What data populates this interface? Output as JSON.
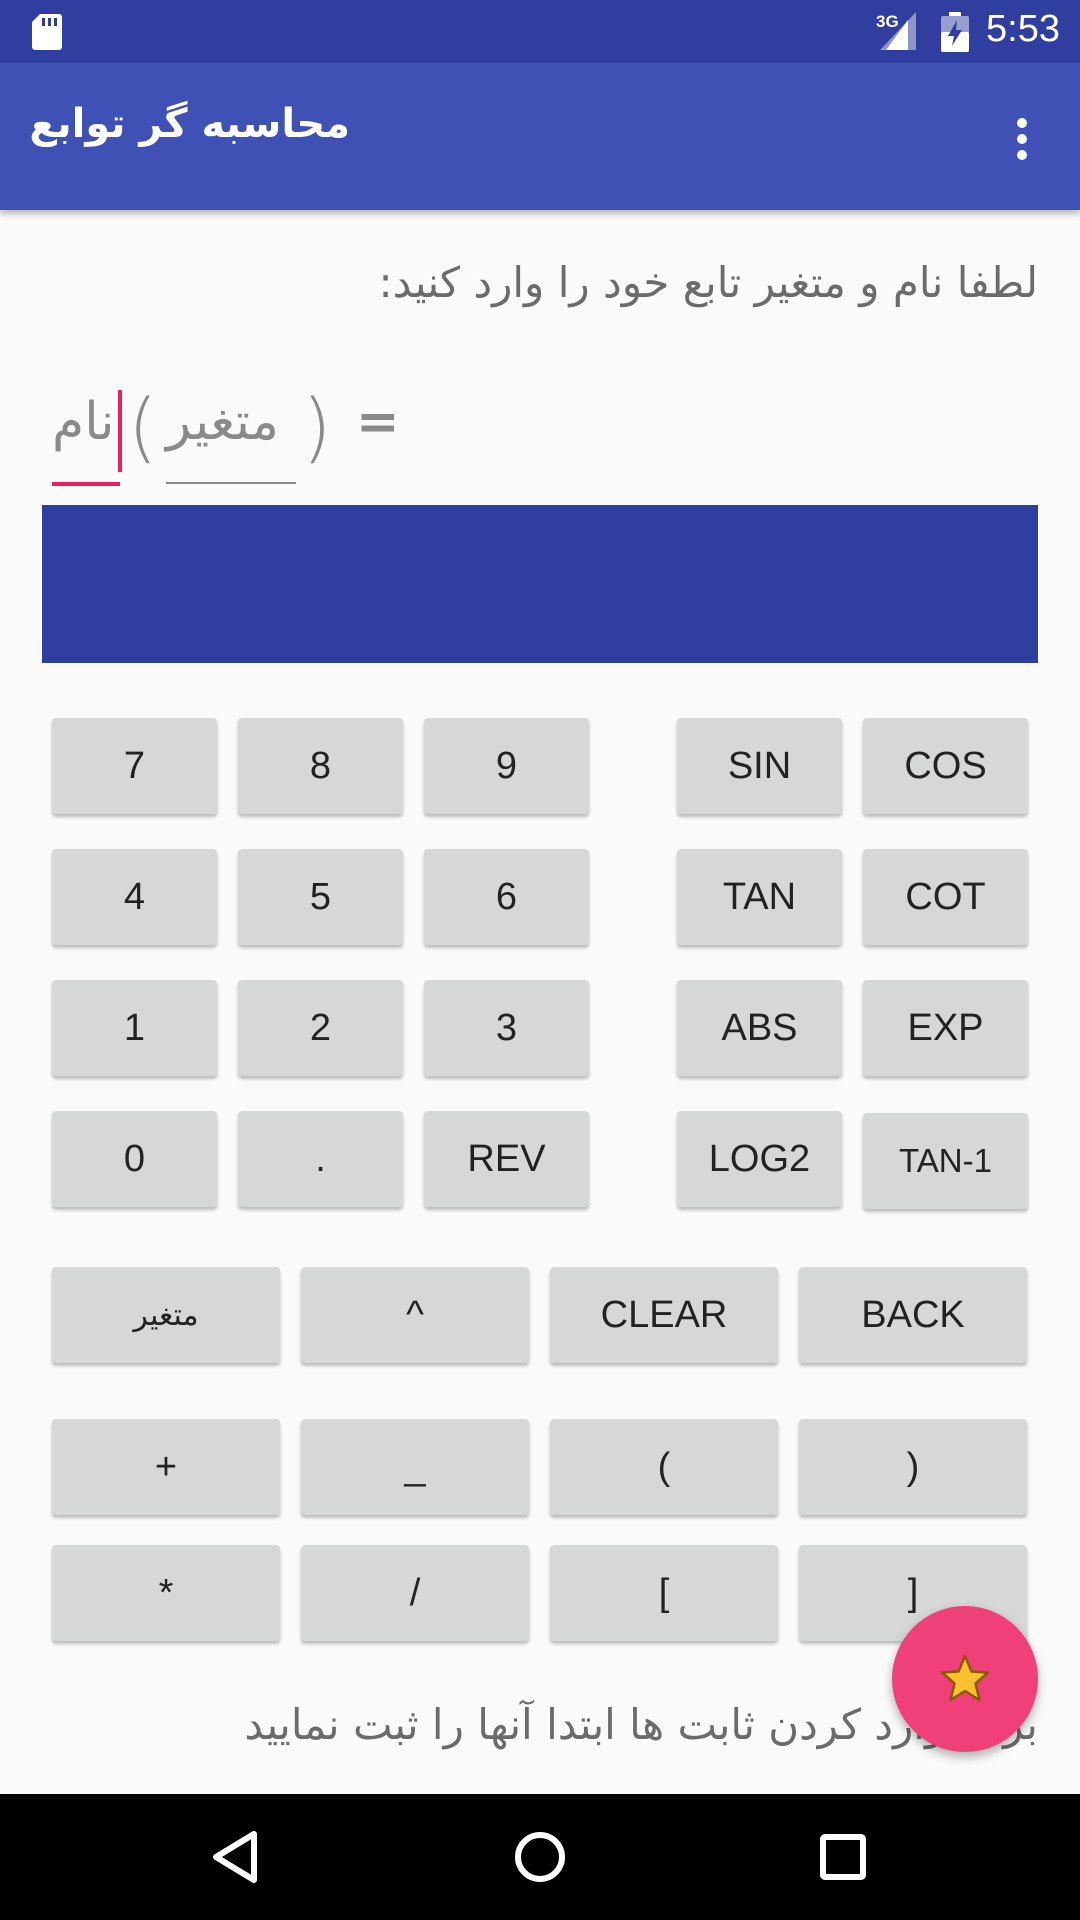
{
  "status_bar": {
    "network": "3G",
    "time": "5:53"
  },
  "app_bar": {
    "title": "محاسبه گر توابع"
  },
  "instruction": "لطفا نام و متغیر تابع خود را وارد کنید:",
  "function_definition": {
    "name_hint": "نام",
    "open_paren": "(",
    "variable_hint": "متغیر",
    "close_paren": ")",
    "equals": "="
  },
  "keypad": {
    "numbers": [
      [
        "7",
        "8",
        "9"
      ],
      [
        "4",
        "5",
        "6"
      ],
      [
        "1",
        "2",
        "3"
      ],
      [
        "0",
        ".",
        "REV"
      ]
    ],
    "functions": [
      [
        "SIN",
        "COS"
      ],
      [
        "TAN",
        "COT"
      ],
      [
        "ABS",
        "EXP"
      ],
      [
        "LOG2",
        "TAN-1"
      ]
    ],
    "controls": [
      "متغیر",
      "^",
      "CLEAR",
      "BACK"
    ],
    "operators_row1": [
      "+",
      "_",
      "(",
      ")"
    ],
    "operators_row2": [
      "*",
      "/",
      "[",
      "]"
    ]
  },
  "bottom_note": "برای وارد کردن ثابت ها ابتدا آنها را ثبت نمایید",
  "colors": {
    "status_bar": "#303f9f",
    "app_bar": "#3f51b5",
    "display": "#303f9f",
    "accent": "#e91e63",
    "fab": "#f0407a",
    "button": "#d6d7d7"
  },
  "icons": {
    "status_left": "sd-card-icon",
    "signal": "signal-icon",
    "battery": "battery-charging-icon",
    "menu": "more-vert-icon",
    "fab": "star-icon",
    "nav": [
      "back-icon",
      "home-icon",
      "recents-icon"
    ]
  }
}
